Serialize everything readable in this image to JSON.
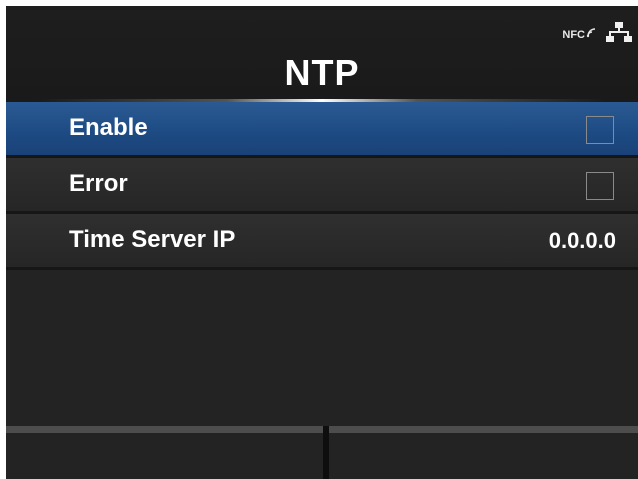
{
  "header": {
    "title": "NTP",
    "status": {
      "nfc_label": "NFC",
      "nfc_icon": "nfc-icon",
      "network_icon": "network-icon"
    }
  },
  "menu": {
    "items": [
      {
        "label": "Enable",
        "control": "checkbox",
        "checked": false,
        "selected": true
      },
      {
        "label": "Error",
        "control": "checkbox",
        "checked": false,
        "selected": false
      },
      {
        "label": "Time Server IP",
        "value": "0.0.0.0",
        "selected": false
      }
    ]
  },
  "footer": {
    "left_label": "",
    "right_label": ""
  },
  "colors": {
    "selection": "#1d4a82",
    "background": "#232323",
    "text": "#ffffff"
  }
}
